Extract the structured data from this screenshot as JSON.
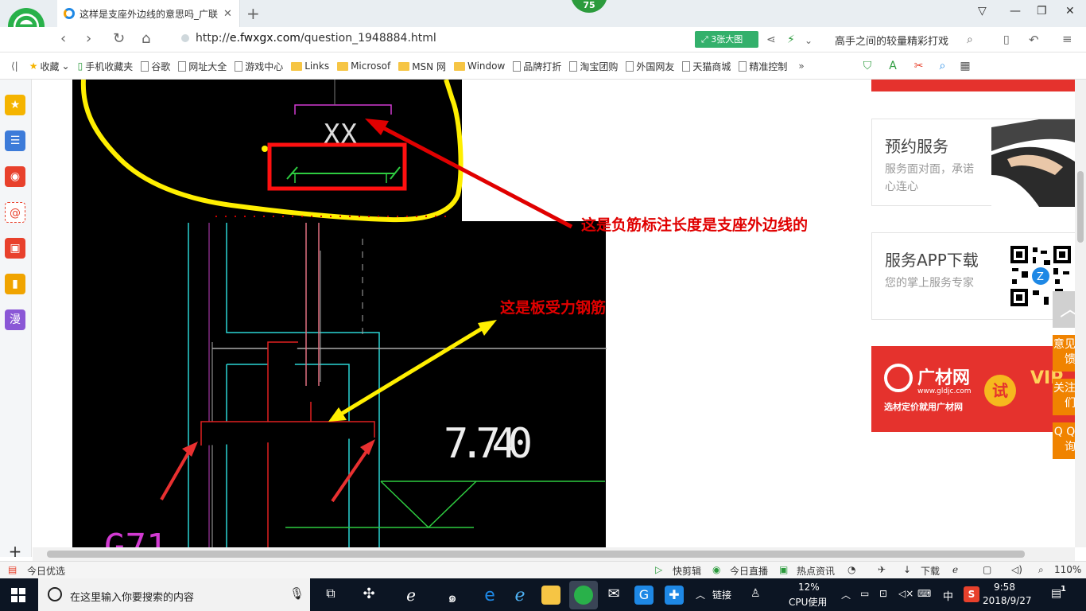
{
  "browser": {
    "tab_title": "这样是支座外边线的意思吗_广联",
    "badge": "75",
    "url_prefix": "http://",
    "url_host": "e.fwxgx.com",
    "url_path": "/question_1948884.html",
    "big_image_button": "3张大图",
    "promo_text": "高手之间的较量精彩打戏"
  },
  "bookmarks": [
    {
      "label": "收藏",
      "icon": "star-icon"
    },
    {
      "label": "手机收藏夹",
      "icon": "phone-icon"
    },
    {
      "label": "谷歌",
      "icon": "page-icon"
    },
    {
      "label": "网址大全",
      "icon": "page-icon"
    },
    {
      "label": "游戏中心",
      "icon": "page-icon"
    },
    {
      "label": "Links",
      "icon": "folder-icon"
    },
    {
      "label": "Microsof",
      "icon": "folder-icon"
    },
    {
      "label": "MSN 网",
      "icon": "folder-icon"
    },
    {
      "label": "Window",
      "icon": "folder-icon"
    },
    {
      "label": "品牌打折",
      "icon": "page-icon"
    },
    {
      "label": "淘宝团购",
      "icon": "page-icon"
    },
    {
      "label": "外国网友",
      "icon": "page-icon"
    },
    {
      "label": "天猫商城",
      "icon": "page-icon"
    },
    {
      "label": "精准控制",
      "icon": "page-icon"
    }
  ],
  "sidebar_icons": [
    {
      "name": "favorites-icon",
      "color": "#f5b400",
      "glyph": "★"
    },
    {
      "name": "news-icon",
      "color": "#3c7bd9",
      "glyph": "☰"
    },
    {
      "name": "weibo-icon",
      "color": "#e8412c",
      "glyph": "◉"
    },
    {
      "name": "mail-icon",
      "color": "#e8412c",
      "glyph": "@"
    },
    {
      "name": "game-icon",
      "color": "#e8412c",
      "glyph": "▣"
    },
    {
      "name": "novel-icon",
      "color": "#f0a400",
      "glyph": "▮"
    },
    {
      "name": "comic-icon",
      "color": "#8a57d6",
      "glyph": "漫"
    }
  ],
  "cad": {
    "label_xx": "XX",
    "elevation": "7.740",
    "annotation_neg_rebar": "这是负筋标注长度是支座外边线的",
    "annotation_slab_rebar": "这是板受力钢筋"
  },
  "right_panel": {
    "card1_title": "预约服务",
    "card1_sub": "服务面对面，承诺心连心",
    "card2_title": "服务APP下载",
    "card2_sub": "您的掌上服务专家",
    "ad_brand": "广材网",
    "ad_site": "www.gldjc.com",
    "ad_slogan": "选材定价就用广材网",
    "ad_try": "试",
    "ad_vip": "VIP"
  },
  "float_buttons": {
    "feedback": "意见反馈",
    "follow": "关注我们",
    "qq": "Q Q咨询"
  },
  "statusbar": {
    "left": "今日优选",
    "kuaijianji": "快剪辑",
    "live": "今日直播",
    "news": "热点资讯",
    "download": "下载",
    "zoom": "110%"
  },
  "taskbar": {
    "search_placeholder": "在这里输入你要搜索的内容",
    "link": "链接",
    "cpu_value": "12%",
    "cpu_label": "CPU使用",
    "ime": "中",
    "time": "9:58",
    "date": "2018/9/27",
    "notification_count": "1"
  }
}
